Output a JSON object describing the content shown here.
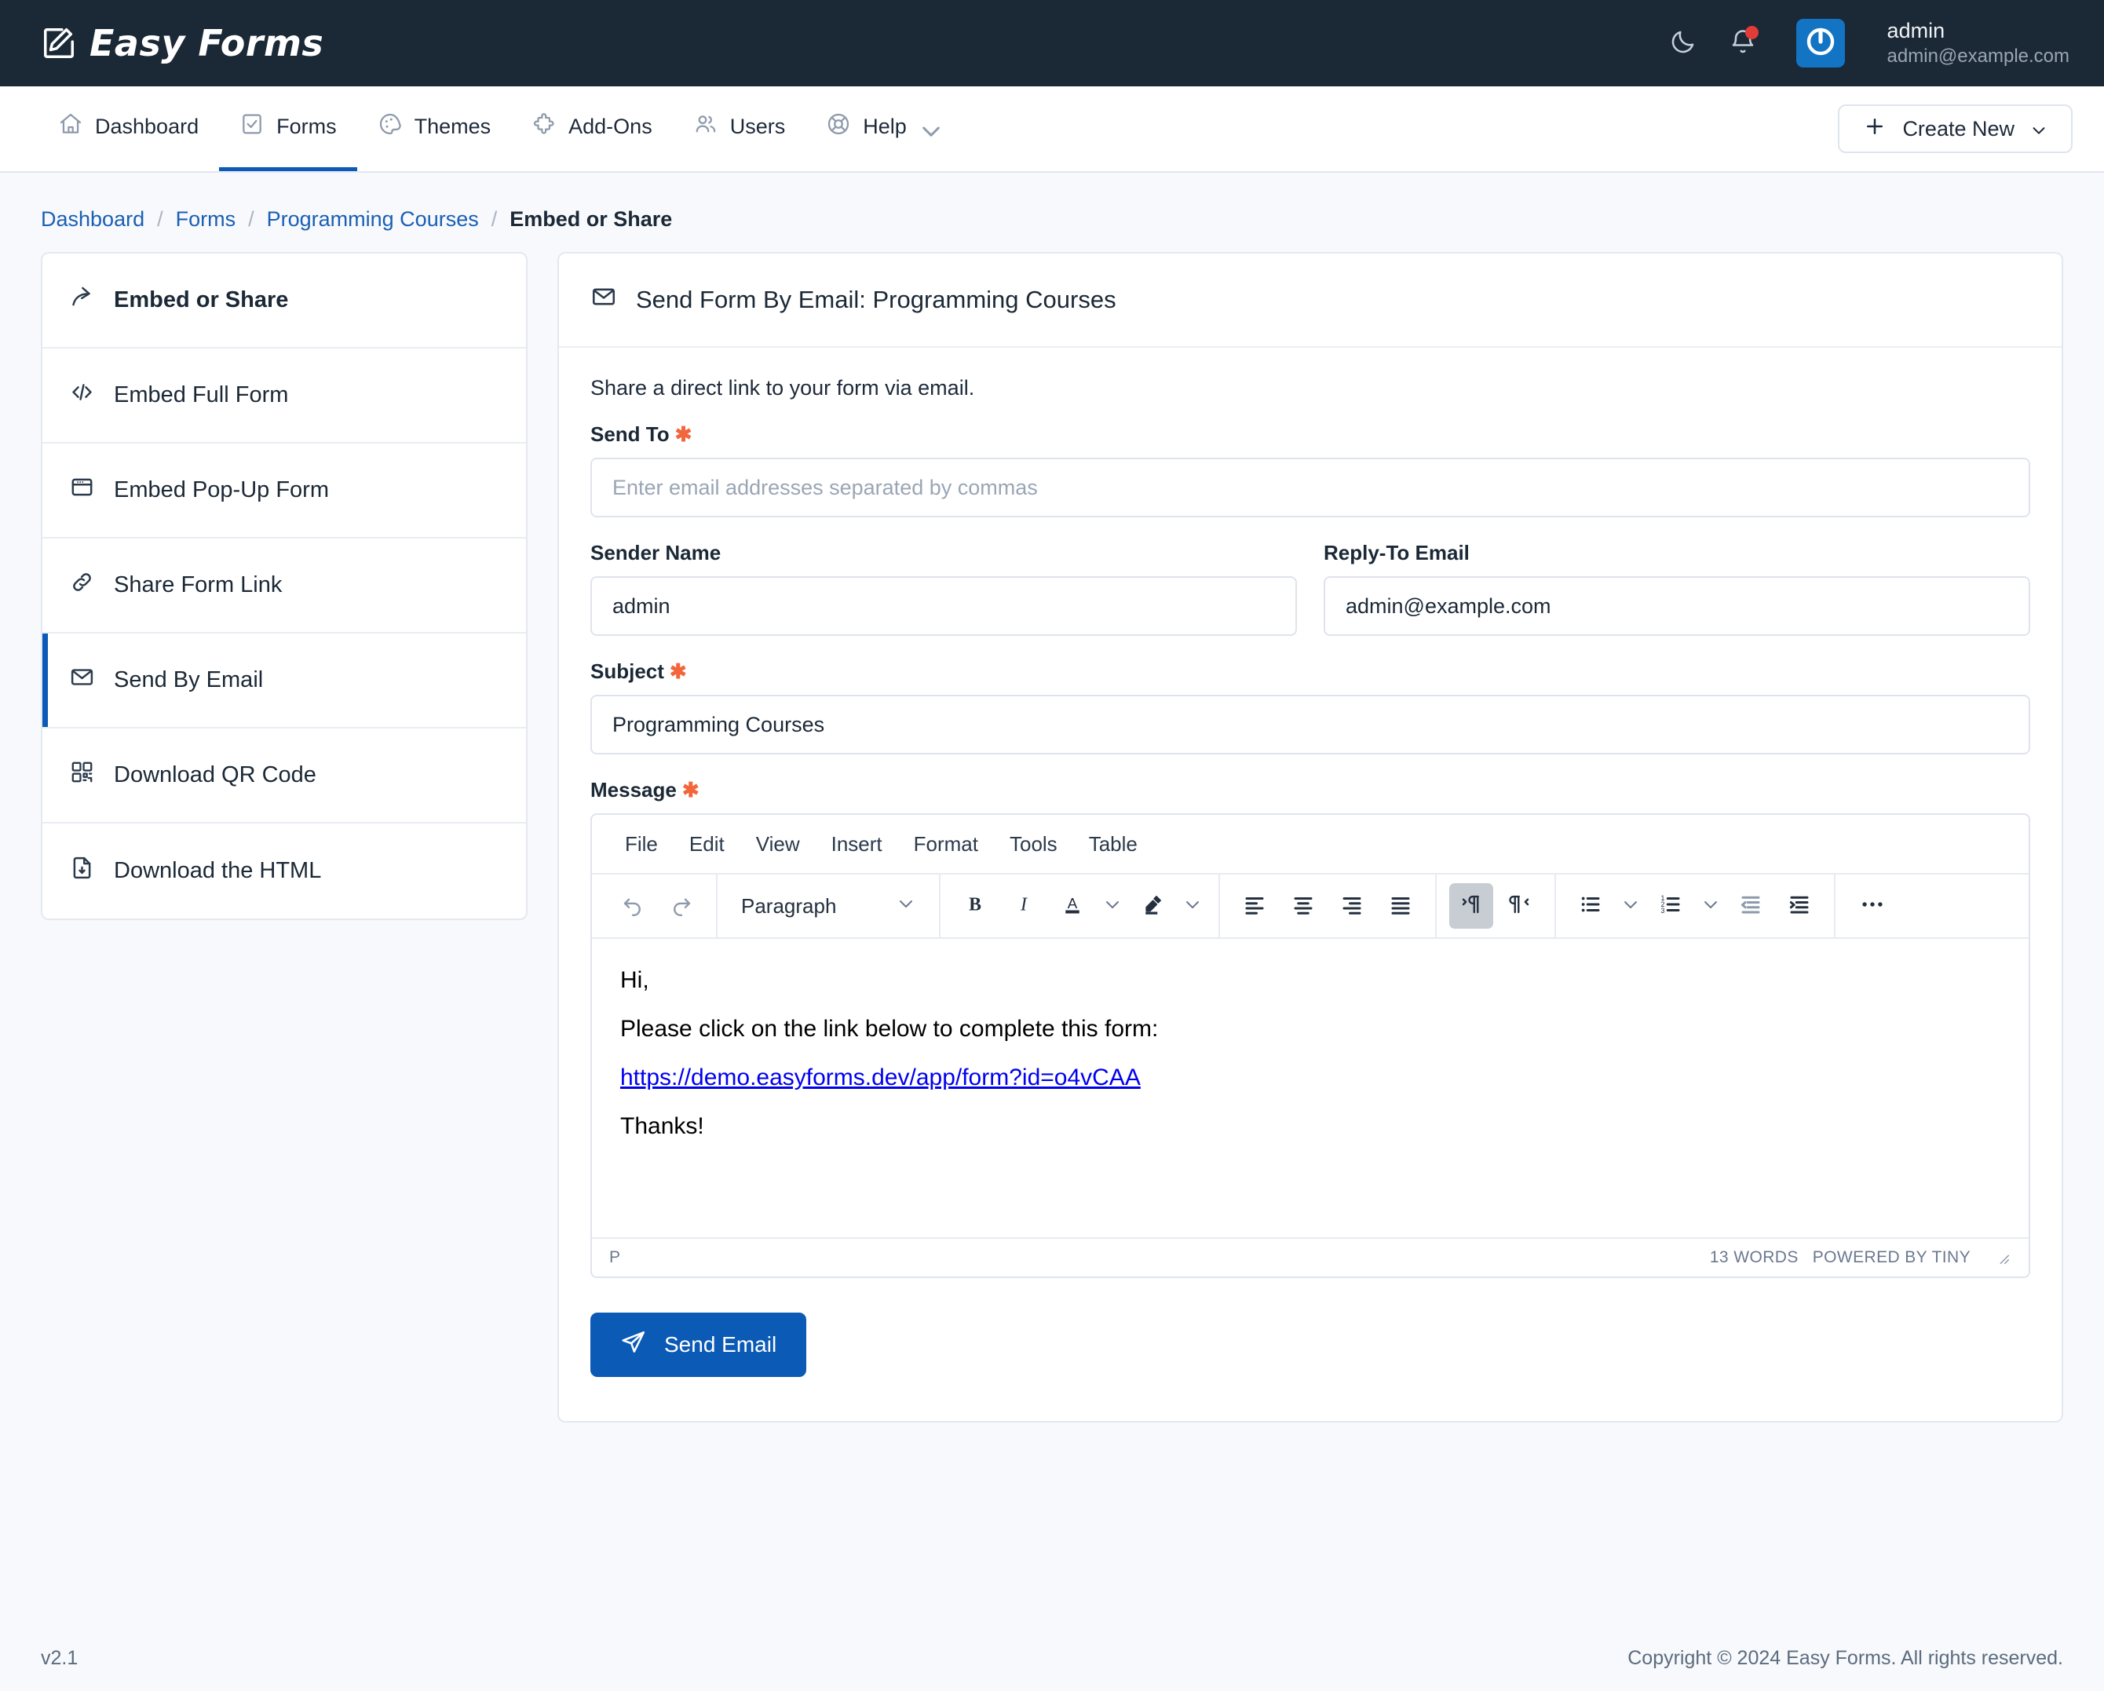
{
  "app": {
    "brand": "Easy Forms",
    "version": "v2.1",
    "copyright": "Copyright © 2024 Easy Forms. All rights reserved.",
    "accent": "#0b5ab5",
    "topbar_bg": "#1b2836",
    "required_color": "#f2663c"
  },
  "topbar": {
    "theme_toggle": "moon-icon",
    "notifications": "bell-icon",
    "user_name": "admin",
    "user_email": "admin@example.com"
  },
  "nav": {
    "items": [
      {
        "label": "Dashboard",
        "icon": "home-icon",
        "active": false
      },
      {
        "label": "Forms",
        "icon": "form-check-icon",
        "active": true
      },
      {
        "label": "Themes",
        "icon": "palette-icon",
        "active": false
      },
      {
        "label": "Add-Ons",
        "icon": "puzzle-icon",
        "active": false
      },
      {
        "label": "Users",
        "icon": "users-icon",
        "active": false
      },
      {
        "label": "Help",
        "icon": "lifebuoy-icon",
        "active": false,
        "caret": true
      }
    ],
    "create_new": "Create New"
  },
  "breadcrumb": {
    "items": [
      "Dashboard",
      "Forms",
      "Programming Courses"
    ],
    "separator": "/",
    "current": "Embed or Share"
  },
  "sidebar": {
    "items": [
      {
        "label": "Embed or Share",
        "icon": "share-arrow-icon",
        "head": true,
        "active": false
      },
      {
        "label": "Embed Full Form",
        "icon": "code-icon",
        "head": false,
        "active": false
      },
      {
        "label": "Embed Pop-Up Form",
        "icon": "window-icon",
        "head": false,
        "active": false
      },
      {
        "label": "Share Form Link",
        "icon": "link-icon",
        "head": false,
        "active": false
      },
      {
        "label": "Send By Email",
        "icon": "envelope-icon",
        "head": false,
        "active": true
      },
      {
        "label": "Download QR Code",
        "icon": "qr-code-icon",
        "head": false,
        "active": false
      },
      {
        "label": "Download the HTML",
        "icon": "file-download-icon",
        "head": false,
        "active": false
      }
    ]
  },
  "main": {
    "title": "Send Form By Email: Programming Courses",
    "title_icon": "envelope-icon",
    "lead": "Share a direct link to your form via email.",
    "fields": {
      "send_to": {
        "label": "Send To",
        "required": true,
        "value": "",
        "placeholder": "Enter email addresses separated by commas"
      },
      "sender_name": {
        "label": "Sender Name",
        "required": false,
        "value": "admin"
      },
      "reply_to": {
        "label": "Reply-To Email",
        "required": false,
        "value": "admin@example.com"
      },
      "subject": {
        "label": "Subject",
        "required": true,
        "value": "Programming Courses"
      },
      "message": {
        "label": "Message",
        "required": true
      }
    },
    "submit": {
      "label": "Send Email",
      "icon": "paper-plane-icon"
    }
  },
  "editor": {
    "menus": [
      "File",
      "Edit",
      "View",
      "Insert",
      "Format",
      "Tools",
      "Table"
    ],
    "format_select": "Paragraph",
    "buttons": [
      {
        "name": "undo",
        "icon": "undo-icon",
        "active": false,
        "dim": true
      },
      {
        "name": "redo",
        "icon": "redo-icon",
        "active": false,
        "dim": true
      },
      {
        "name": "bold",
        "icon": "bold-icon",
        "active": false
      },
      {
        "name": "italic",
        "icon": "italic-icon",
        "active": false
      },
      {
        "name": "text-color",
        "icon": "text-color-icon",
        "active": false
      },
      {
        "name": "highlight-color",
        "icon": "highlighter-icon",
        "active": false
      },
      {
        "name": "align-left",
        "icon": "align-left-icon",
        "active": false
      },
      {
        "name": "align-center",
        "icon": "align-center-icon",
        "active": false
      },
      {
        "name": "align-right",
        "icon": "align-right-icon",
        "active": false
      },
      {
        "name": "align-justify",
        "icon": "align-justify-icon",
        "active": false
      },
      {
        "name": "ltr",
        "icon": "direction-ltr-icon",
        "active": true
      },
      {
        "name": "rtl",
        "icon": "direction-rtl-icon",
        "active": false
      },
      {
        "name": "bullet-list",
        "icon": "bullet-list-icon",
        "active": false
      },
      {
        "name": "numbered-list",
        "icon": "numbered-list-icon",
        "active": false
      },
      {
        "name": "outdent",
        "icon": "outdent-icon",
        "active": false,
        "dim": true
      },
      {
        "name": "indent",
        "icon": "indent-icon",
        "active": false
      },
      {
        "name": "more",
        "icon": "ellipsis-icon",
        "active": false
      }
    ],
    "content": {
      "greeting": "Hi,",
      "instruction": "Please click on the link below to complete this form:",
      "link": "https://demo.easyforms.dev/app/form?id=o4vCAA",
      "closing": "Thanks!"
    },
    "status": {
      "path": "P",
      "word_count": "13 WORDS",
      "branding": "POWERED BY TINY"
    }
  }
}
